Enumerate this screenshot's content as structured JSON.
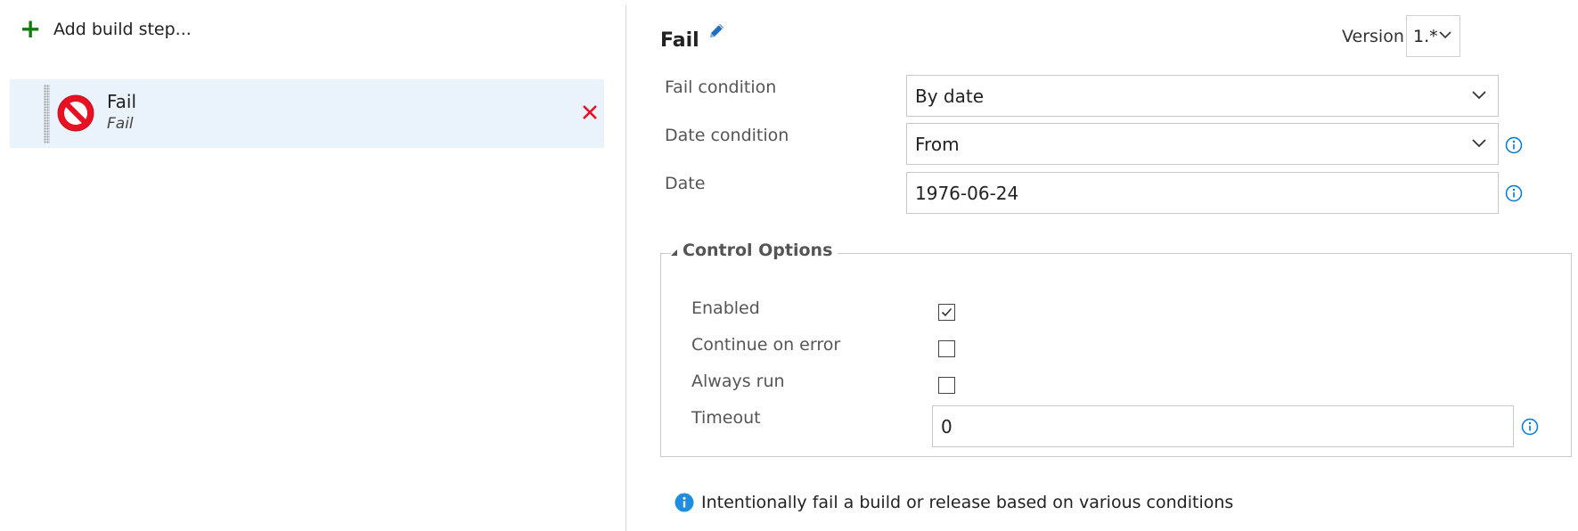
{
  "add_step": {
    "icon": "plus-icon",
    "label": "Add build step..."
  },
  "task_list": [
    {
      "name": "Fail",
      "subtitle": "Fail",
      "icon": "no-entry-icon",
      "remove_icon": "close-icon"
    }
  ],
  "task": {
    "title": "Fail",
    "edit_icon": "pencil-icon",
    "version_label": "Version",
    "version_value": "1.*"
  },
  "fields": {
    "fail_condition": {
      "label": "Fail condition",
      "value": "By date"
    },
    "date_condition": {
      "label": "Date condition",
      "value": "From"
    },
    "date": {
      "label": "Date",
      "value": "1976-06-24"
    }
  },
  "control_options": {
    "title": "Control Options",
    "enabled": {
      "label": "Enabled",
      "checked": true
    },
    "continue_on_error": {
      "label": "Continue on error",
      "checked": false
    },
    "always_run": {
      "label": "Always run",
      "checked": false
    },
    "timeout": {
      "label": "Timeout",
      "value": "0"
    }
  },
  "description": "Intentionally fail a build or release based on various conditions",
  "colors": {
    "accent_blue": "#0078d4",
    "add_green": "#107c10",
    "remove_red": "#e81123",
    "selected_bg": "#eaf2fb"
  }
}
